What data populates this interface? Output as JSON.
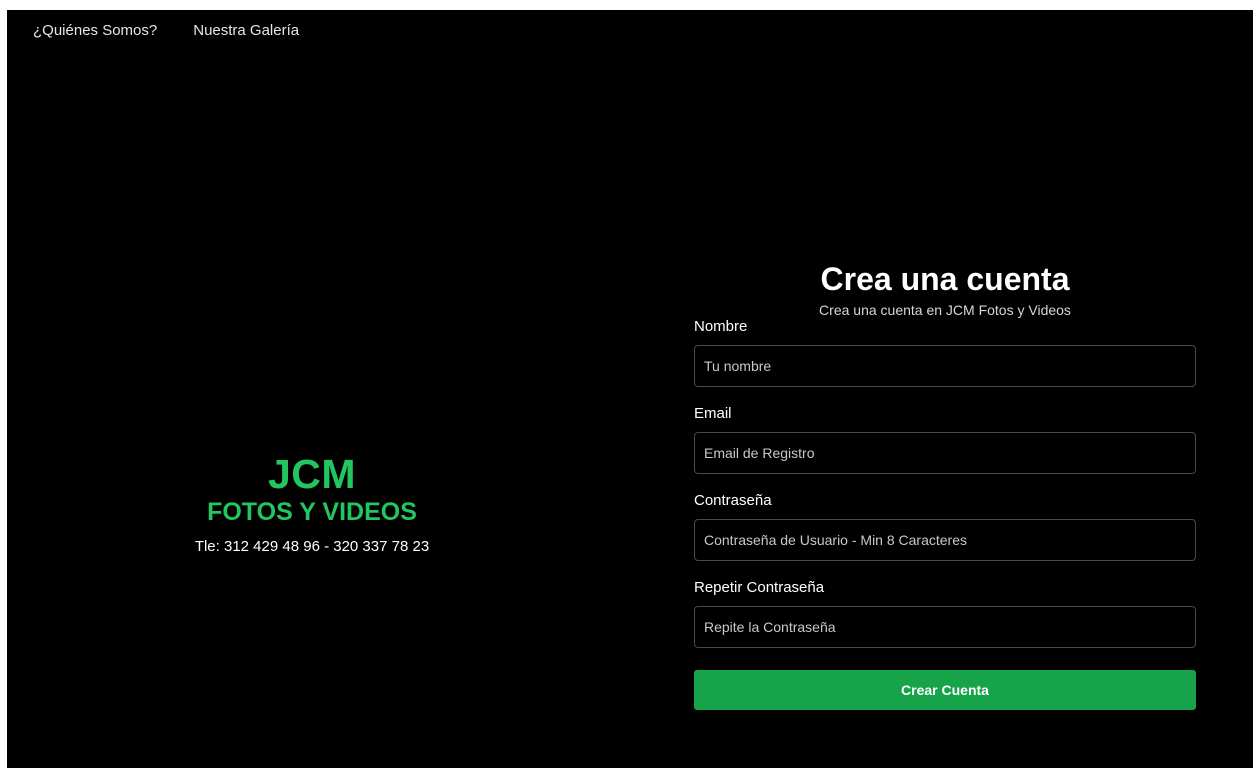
{
  "nav": {
    "about": "¿Quiénes Somos?",
    "gallery": "Nuestra Galería"
  },
  "brand": {
    "title": "JCM",
    "subtitle": "FOTOS Y VIDEOS",
    "phone": "Tle: 312 429 48 96 - 320 337 78 23"
  },
  "form": {
    "title": "Crea una cuenta",
    "subtitle": "Crea una cuenta en JCM Fotos y Videos",
    "fields": [
      {
        "label": "Nombre",
        "placeholder": "Tu nombre",
        "value": ""
      },
      {
        "label": "Email",
        "placeholder": "Email de Registro",
        "value": ""
      },
      {
        "label": "Contraseña",
        "placeholder": "Contraseña de Usuario - Min 8 Caracteres",
        "value": ""
      },
      {
        "label": "Repetir Contraseña",
        "placeholder": "Repite la Contraseña",
        "value": ""
      }
    ],
    "submit_label": "Crear Cuenta"
  },
  "colors": {
    "background": "#000000",
    "accent": "#22c55e",
    "button": "#16a34a",
    "text": "#ffffff"
  }
}
